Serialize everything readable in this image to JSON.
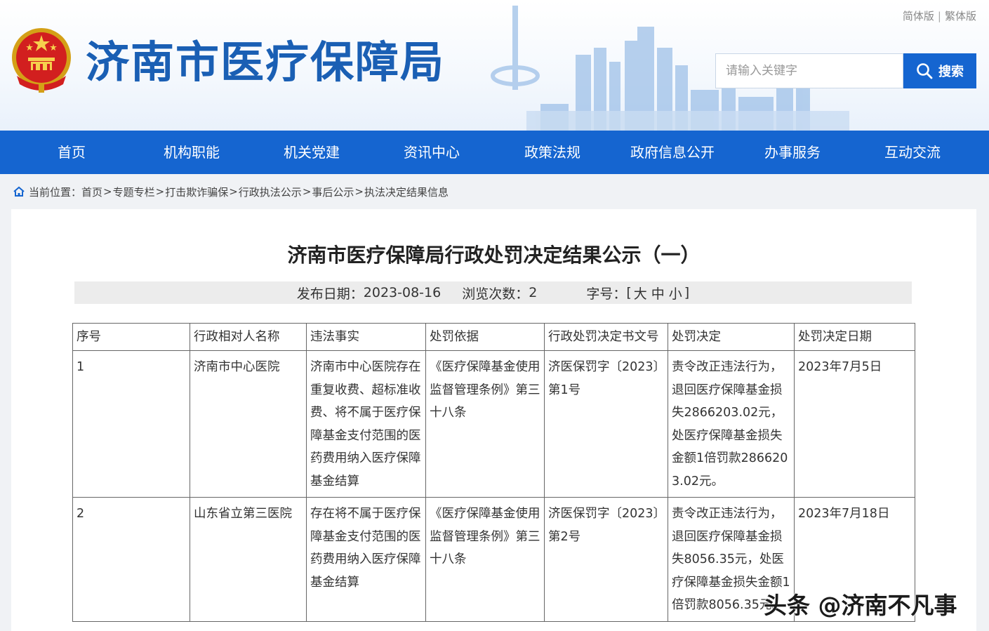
{
  "header": {
    "site_title": "济南市医疗保障局",
    "lang_simplified": "简体版",
    "lang_separator": "|",
    "lang_traditional": "繁体版",
    "search_placeholder": "请输入关键字",
    "search_button": "搜索",
    "brand_color": "#1565d0"
  },
  "nav": {
    "items": [
      "首页",
      "机构职能",
      "机关党建",
      "资讯中心",
      "政策法规",
      "政府信息公开",
      "办事服务",
      "互动交流"
    ]
  },
  "breadcrumb": {
    "prefix": "当前位置：",
    "items": [
      "首页",
      "专题专栏",
      "打击欺诈骗保",
      "行政执法公示",
      "事后公示",
      "执法决定结果信息"
    ],
    "separator": ">"
  },
  "article": {
    "title": "济南市医疗保障局行政处罚决定结果公示（一）",
    "publish_label": "发布日期：",
    "publish_date": "2023-08-16",
    "views_label": "浏览次数：",
    "views": "2",
    "font_label": "字号：",
    "font_open": "[",
    "font_large": "大",
    "font_medium": "中",
    "font_small": "小",
    "font_close": "]"
  },
  "table": {
    "headers": [
      "序号",
      "行政相对人名称",
      "违法事实",
      "处罚依据",
      "行政处罚决定书文号",
      "处罚决定",
      "处罚决定日期"
    ],
    "rows": [
      [
        "1",
        "济南市中心医院",
        "济南市中心医院存在重复收费、超标准收费、将不属于医疗保障基金支付范围的医药费用纳入医疗保障基金结算",
        "《医疗保障基金使用监督管理条例》第三十八条",
        "济医保罚字〔2023〕第1号",
        "责令改正违法行为，退回医疗保障基金损失2866203.02元，处医疗保障基金损失金额1倍罚款2866203.02元。",
        "2023年7月5日"
      ],
      [
        "2",
        "山东省立第三医院",
        "存在将不属于医疗保障基金支付范围的医药费用纳入医疗保障基金结算",
        "《医疗保障基金使用监督管理条例》第三十八条",
        "济医保罚字〔2023〕第2号",
        "责令改正违法行为，退回医疗保障基金损失8056.35元，处医疗保障基金损失金额1倍罚款8056.35元。",
        "2023年7月18日"
      ]
    ]
  },
  "watermark": "头条 @济南不凡事"
}
